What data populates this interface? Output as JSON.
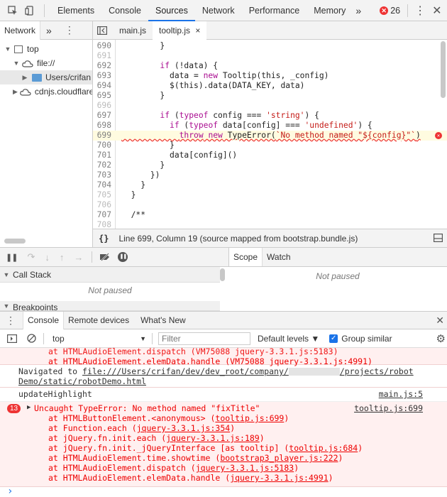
{
  "toolbar": {
    "tabs": [
      "Elements",
      "Console",
      "Sources",
      "Network",
      "Performance",
      "Memory"
    ],
    "active_tab": "Sources",
    "more": "»",
    "error_count": "26"
  },
  "navigator": {
    "tabs": [
      "Network"
    ],
    "more": "»",
    "tree": [
      {
        "label": "top"
      },
      {
        "label": "file://"
      },
      {
        "label": "Users/crifan"
      },
      {
        "label": "cdnjs.cloudflare"
      }
    ]
  },
  "editor": {
    "tabs": [
      {
        "label": "main.js"
      },
      {
        "label": "tooltip.js"
      }
    ],
    "close_glyph": "×",
    "lines": [
      {
        "n": "690",
        "t": "        }"
      },
      {
        "n": "691",
        "t": ""
      },
      {
        "n": "692",
        "t": "        if (!data) {"
      },
      {
        "n": "693",
        "t": "          data = new Tooltip(this, _config)"
      },
      {
        "n": "694",
        "t": "          $(this).data(DATA_KEY, data)"
      },
      {
        "n": "695",
        "t": "        }"
      },
      {
        "n": "696",
        "t": ""
      },
      {
        "n": "697",
        "t": "        if (typeof config === 'string') {"
      },
      {
        "n": "698",
        "t": "          if (typeof data[config] === 'undefined') {"
      },
      {
        "n": "699",
        "t": "            throw new TypeError(`No method named \"${config}\"`)"
      },
      {
        "n": "700",
        "t": "          }"
      },
      {
        "n": "701",
        "t": "          data[config]()"
      },
      {
        "n": "702",
        "t": "        }"
      },
      {
        "n": "703",
        "t": "      })"
      },
      {
        "n": "704",
        "t": "    }"
      },
      {
        "n": "705",
        "t": "  }"
      },
      {
        "n": "706",
        "t": ""
      },
      {
        "n": "707",
        "t": "  /**"
      },
      {
        "n": "708",
        "t": ""
      }
    ],
    "status": "Line 699, Column 19  (source mapped from bootstrap.bundle.js)",
    "status_icon": "{}"
  },
  "debugger": {
    "call_stack": "Call Stack",
    "not_paused": "Not paused",
    "breakpoints": "Breakpoints",
    "scope_tab": "Scope",
    "watch_tab": "Watch"
  },
  "drawer": {
    "tabs": [
      "Console",
      "Remote devices",
      "What's New"
    ],
    "context": "top",
    "filter_placeholder": "Filter",
    "levels": "Default levels ▼",
    "group_similar": "Group similar"
  },
  "console": {
    "pre": [
      {
        "text": "at HTMLAudioElement.dispatch (VM75088 jquery-3.3.1.js:5183)"
      },
      {
        "text": "at HTMLAudioElement.elemData.handle (VM75088 jquery-3.3.1.js:4991)"
      }
    ],
    "navigated_prefix": "Navigated to ",
    "navigated_url1": "file:///Users/crifan/dev/dev_root/company/",
    "navigated_url2": "/projects/robot",
    "navigated_url3": "Demo/static/robotDemo.html",
    "log_text": "updateHighlight",
    "log_src": "main.js:5",
    "error_count": "13",
    "error_text": "Uncaught TypeError: No method named \"fixTitle\"",
    "error_src": "tooltip.js:699",
    "stack": [
      {
        "pre": "at HTMLButtonElement.<anonymous> (",
        "link": "tooltip.js:699",
        "post": ")"
      },
      {
        "pre": "at Function.each (",
        "link": "jquery-3.3.1.js:354",
        "post": ")"
      },
      {
        "pre": "at jQuery.fn.init.each (",
        "link": "jquery-3.3.1.js:189",
        "post": ")"
      },
      {
        "pre": "at jQuery.fn.init._jQueryInterface [as tooltip] (",
        "link": "tooltip.js:684",
        "post": ")"
      },
      {
        "pre": "at HTMLAudioElement.time.showtime (",
        "link": "bootstrap3_player.js:222",
        "post": ")"
      },
      {
        "pre": "at HTMLAudioElement.dispatch (",
        "link": "jquery-3.3.1.js:5183",
        "post": ")"
      },
      {
        "pre": "at HTMLAudioElement.elemData.handle (",
        "link": "jquery-3.3.1.js:4991",
        "post": ")"
      }
    ],
    "prompt": "›"
  },
  "colors": {
    "accent": "#1a73e8",
    "error_bg": "#fff0f0",
    "error_text": "#e00",
    "keyword": "#aa0d91",
    "string": "#c41a16"
  }
}
